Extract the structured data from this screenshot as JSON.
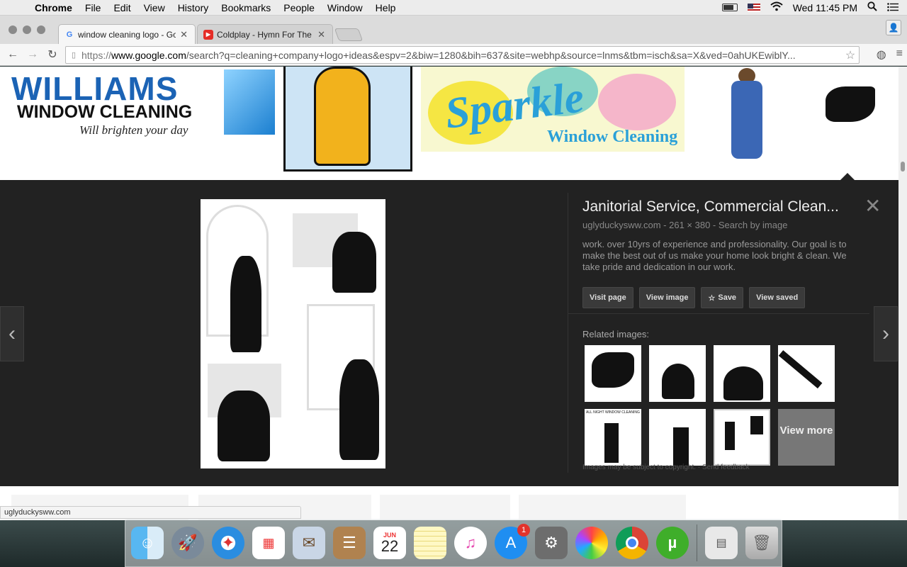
{
  "menubar": {
    "app": "Chrome",
    "items": [
      "File",
      "Edit",
      "View",
      "History",
      "Bookmarks",
      "People",
      "Window",
      "Help"
    ],
    "clock": "Wed 11:45 PM"
  },
  "tabs": [
    {
      "title": "window cleaning logo - Goo",
      "favicon": "G",
      "active": true
    },
    {
      "title": "Coldplay - Hymn For The W",
      "favicon": "youtube-icon",
      "active": false
    }
  ],
  "omnibox": {
    "url_prefix": "https://",
    "url_host": "www.google.com",
    "url_rest": "/search?q=cleaning+company+logo+ideas&espv=2&biw=1280&bih=637&site=webhp&source=lnms&tbm=isch&sa=X&ved=0ahUKEwiblY..."
  },
  "thumbnails": {
    "williams": {
      "line1": "WILLIAMS",
      "line2": "WINDOW CLEANING",
      "line3": "Will brighten your day"
    },
    "sparkle": {
      "line1": "Sparkle",
      "line2": "Window Cleaning"
    }
  },
  "panel": {
    "title": "Janitorial Service, Commercial Clean...",
    "source": "uglyduckysww.com",
    "dimensions": "261 × 380",
    "search_by_image": "Search by image",
    "description": "work. over 10yrs of experience and professionality. Our goal is to make the best out of us make your home look bright & clean. We take pride and dedication in our work.",
    "buttons": {
      "visit": "Visit page",
      "view_image": "View image",
      "save": "Save",
      "view_saved": "View saved"
    },
    "related_label": "Related images:",
    "view_more": "View more",
    "related_caption": "ALL NIGHT WINDOW CLEANING",
    "copyright": "Images may be subject to copyright. · Send feedback"
  },
  "status_bar": "uglyduckysww.com",
  "dock": {
    "calendar_month": "JUN",
    "calendar_day": "22",
    "appstore_badge": "1",
    "items": [
      "Finder",
      "Launchpad",
      "Safari",
      "Calendar Grid",
      "Mail",
      "Contacts",
      "Calendar",
      "Notes",
      "iTunes",
      "App Store",
      "System Preferences",
      "Photos",
      "Chrome",
      "uTorrent",
      "Documents",
      "Trash"
    ]
  }
}
